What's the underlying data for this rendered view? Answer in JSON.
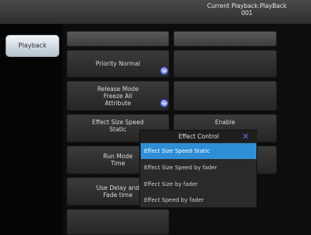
{
  "header": {
    "status_text": "Current Playback:PlayBack\n001"
  },
  "sidebar": {
    "tab_label": "Playback"
  },
  "grid": {
    "priority_label": "Priority Normal",
    "release_label": "Release Mode\nFreeze All\nAttribute",
    "effect_size_speed_label": "Effect Size Speed\nStatic",
    "enable_label": "Enable",
    "run_mode_label": "Run Mode\nTime",
    "use_delay_label": "Use Delay and\nFade time"
  },
  "popup": {
    "title": "Effect Control",
    "close_glyph": "✕",
    "options": [
      "Effect Size Speed Static",
      "Effect Size Speed by fader",
      "Effect Size by fader",
      "Effect Speed by fader"
    ],
    "selected_index": 0
  },
  "colors": {
    "accent": "#2f8ed6",
    "circle_button": "#5560c8"
  }
}
